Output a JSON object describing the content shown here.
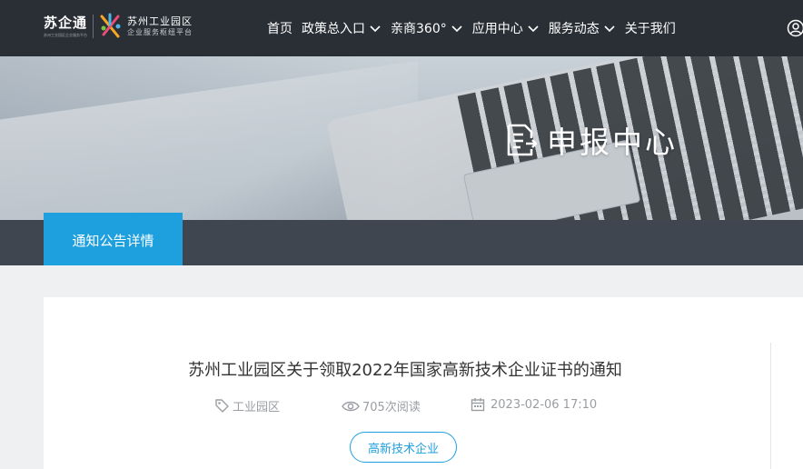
{
  "brand": {
    "logo_text": "苏企通",
    "logo_subtext": "苏州工业园区企业服务平台",
    "park_title": "苏州工业园区",
    "park_subtitle": "企业服务枢纽平台"
  },
  "nav": {
    "items": [
      {
        "label": "首页",
        "has_dropdown": false
      },
      {
        "label": "政策总入口",
        "has_dropdown": true
      },
      {
        "label": "亲商360°",
        "has_dropdown": true
      },
      {
        "label": "应用中心",
        "has_dropdown": true
      },
      {
        "label": "服务动态",
        "has_dropdown": true
      },
      {
        "label": "关于我们",
        "has_dropdown": false
      }
    ],
    "user_icon": "user-circle-icon"
  },
  "banner": {
    "title": "申报中心",
    "icon": "document-edit-icon"
  },
  "tabs": {
    "active_label": "通知公告详情"
  },
  "article": {
    "title": "苏州工业园区关于领取2022年国家高新技术企业证书的通知",
    "source": "工业园区",
    "reads": "705次阅读",
    "date": "2023-02-06 17:10",
    "tag": "高新技术企业"
  },
  "colors": {
    "nav_bg": "#2a2f36",
    "accent": "#1e9fde",
    "tabbar_bg": "#3f4650",
    "meta_text": "#9a9ea3"
  }
}
